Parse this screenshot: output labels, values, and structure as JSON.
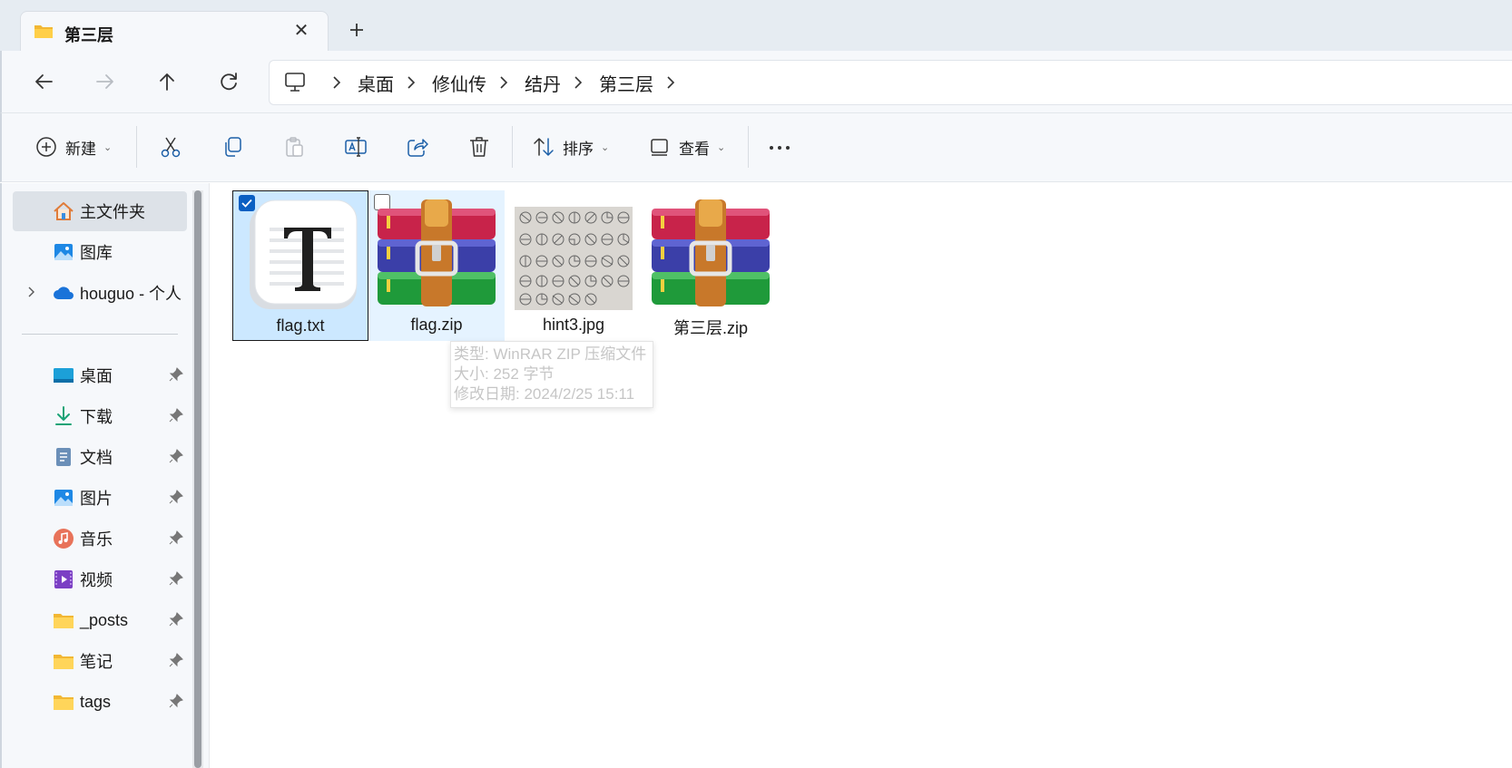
{
  "tab": {
    "title": "第三层",
    "close": "✕",
    "new_tab": "+"
  },
  "breadcrumb": [
    "桌面",
    "修仙传",
    "结丹",
    "第三层"
  ],
  "toolbar": {
    "new_label": "新建",
    "sort_label": "排序",
    "view_label": "查看",
    "more_label": "..."
  },
  "sidebar": {
    "top_items": [
      {
        "label": "主文件夹",
        "icon": "home-icon",
        "selected": true
      },
      {
        "label": "图库",
        "icon": "gallery-icon"
      },
      {
        "label": "houguo - 个人",
        "icon": "onedrive-cloud-icon"
      }
    ],
    "pinned_items": [
      {
        "label": "桌面",
        "icon": "desktop-icon"
      },
      {
        "label": "下载",
        "icon": "download-icon"
      },
      {
        "label": "文档",
        "icon": "document-icon"
      },
      {
        "label": "图片",
        "icon": "pictures-icon"
      },
      {
        "label": "音乐",
        "icon": "music-icon"
      },
      {
        "label": "视频",
        "icon": "video-icon"
      },
      {
        "label": "_posts",
        "icon": "folder-icon"
      },
      {
        "label": "笔记",
        "icon": "folder-icon"
      },
      {
        "label": "tags",
        "icon": "folder-icon"
      }
    ]
  },
  "files": [
    {
      "name": "flag.txt",
      "icon": "text-file-icon",
      "selected": true,
      "checked": true
    },
    {
      "name": "flag.zip",
      "icon": "winrar-archive-icon",
      "hover": true,
      "checked": false
    },
    {
      "name": "hint3.jpg",
      "icon": "image-thumbnail-icon"
    },
    {
      "name": "第三层.zip",
      "icon": "winrar-archive-icon"
    }
  ],
  "tooltip": {
    "line1": "类型: WinRAR ZIP 压缩文件",
    "line2": "大小: 252 字节",
    "line3": "修改日期: 2024/2/25 15:11"
  },
  "colors": {
    "accent": "#0a5fc2",
    "selection_bg": "#cce8ff",
    "hover_bg": "#e5f3ff",
    "chrome_bg": "#f6f8fb",
    "tabbar_bg": "#e6ecf2"
  }
}
